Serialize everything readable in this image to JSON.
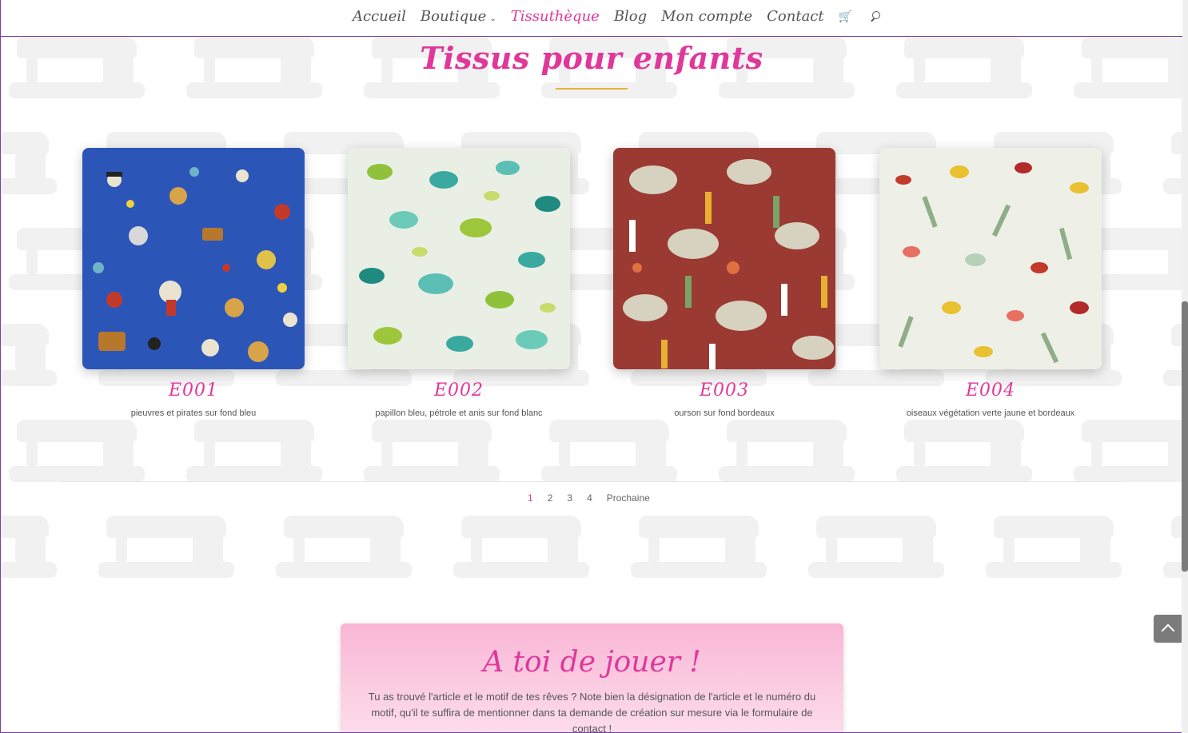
{
  "nav": {
    "items": [
      {
        "label": "Accueil"
      },
      {
        "label": "Boutique"
      },
      {
        "label": "Tissuthèque"
      },
      {
        "label": "Blog"
      },
      {
        "label": "Mon compte"
      },
      {
        "label": "Contact"
      }
    ],
    "active": "Tissuthèque",
    "cart_icon": "cart-icon",
    "search_icon": "search-icon"
  },
  "section": {
    "title": "Tissus pour enfants"
  },
  "products": [
    {
      "code": "E001",
      "description": "pieuvres et pirates sur fond bleu",
      "background": "#2c55b8"
    },
    {
      "code": "E002",
      "description": "papillon bleu, pétrole et anis sur fond blanc",
      "background": "#eaefe6"
    },
    {
      "code": "E003",
      "description": "ourson sur fond bordeaux",
      "background": "#9a3a32"
    },
    {
      "code": "E004",
      "description": "oiseaux végétation verte jaune et bordeaux",
      "background": "#eef0e8"
    }
  ],
  "pagination": {
    "pages": [
      "1",
      "2",
      "3",
      "4"
    ],
    "current": "1",
    "next_label": "Prochaine"
  },
  "cta": {
    "title": "A toi de jouer !",
    "text": "Tu as trouvé l'article et le motif de tes rêves ? Note bien la désignation de l'article et le numéro du motif, qu'il te suffira de mentionner dans ta demande de création sur mesure via le formulaire de contact !"
  },
  "colors": {
    "accent": "#e0379a",
    "rule": "#e9b23a",
    "cta_top": "#f9b6d5",
    "cta_bottom": "#fde0ee"
  }
}
